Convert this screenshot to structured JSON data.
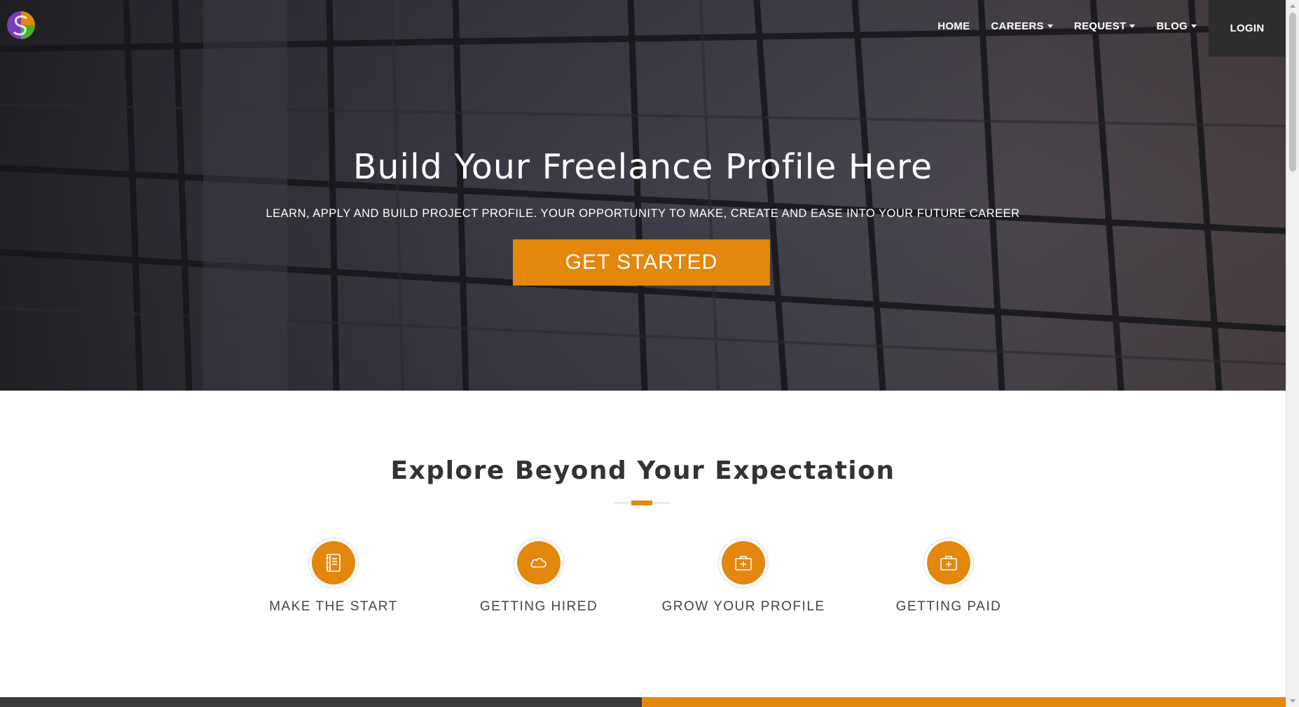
{
  "brand": {
    "accent": "#e3870d",
    "logo_alt": "S"
  },
  "nav": {
    "items": [
      {
        "label": "HOME",
        "dropdown": false
      },
      {
        "label": "CAREERS",
        "dropdown": true
      },
      {
        "label": "REQUEST",
        "dropdown": true
      },
      {
        "label": "BLOG",
        "dropdown": true
      }
    ],
    "login": "LOGIN"
  },
  "hero": {
    "title": "Build Your Freelance Profile Here",
    "subtitle": "LEARN, APPLY AND BUILD PROJECT PROFILE. YOUR OPPORTUNITY TO MAKE, CREATE AND EASE INTO YOUR FUTURE CAREER",
    "cta": "GET STARTED"
  },
  "explore": {
    "title": "Explore Beyond Your Expectation",
    "features": [
      {
        "label": "MAKE THE START",
        "icon": "notebook-icon"
      },
      {
        "label": "GETTING HIRED",
        "icon": "cloud-icon"
      },
      {
        "label": "GROW YOUR PROFILE",
        "icon": "medical-briefcase-icon"
      },
      {
        "label": "GETTING PAID",
        "icon": "medical-briefcase-icon"
      }
    ]
  }
}
